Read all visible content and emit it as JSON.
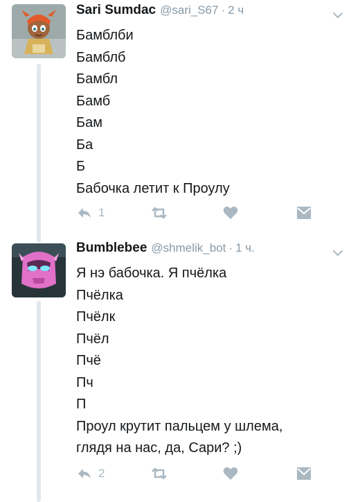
{
  "tweets": [
    {
      "name": "Sari Sumdac",
      "handle": "@sari_S67",
      "dot": "·",
      "time": "2 ч",
      "lines": [
        "Бамблби",
        "Бамблб",
        "Бамбл",
        "Бамб",
        "Бам",
        "Ба",
        "Б",
        "Бабочка летит к Проулу"
      ],
      "reply_count": "1"
    },
    {
      "name": "Bumblebee",
      "handle": "@shmelik_bot",
      "dot": "·",
      "time": "1 ч.",
      "lines": [
        "Я нэ бабочка. Я пчёлка",
        "Пчёлка",
        "Пчёлк",
        "Пчёл",
        "Пчё",
        "Пч",
        "П",
        "Проул крутит пальцем у шлема,",
        "глядя на нас, да, Сари? ;)"
      ],
      "reply_count": "2"
    }
  ],
  "colors": {
    "muted": "#aab8c2",
    "secondary": "#8899a6",
    "text": "#14171a",
    "line": "#e1e8ed"
  },
  "icons": [
    "chevron-down-icon",
    "reply-icon",
    "retweet-icon",
    "like-icon",
    "dm-icon"
  ]
}
